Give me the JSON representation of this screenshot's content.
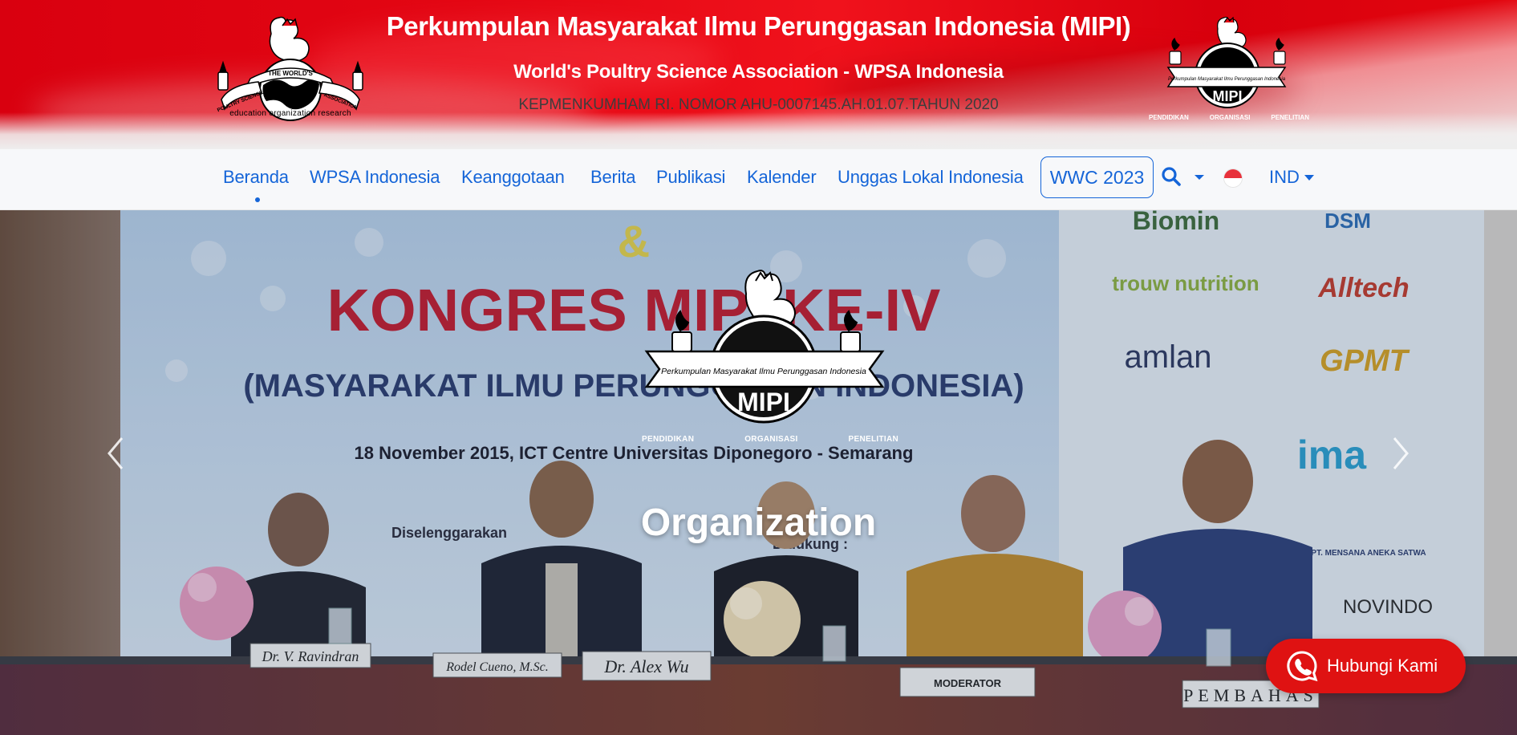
{
  "header": {
    "title": "Perkumpulan Masyarakat Ilmu Perunggasan Indonesia (MIPI)",
    "subtitle": "World's Poultry Science Association - WPSA Indonesia",
    "registration": "KEPMENKUMHAM RI. NOMOR AHU-0007145.AH.01.07.TAHUN 2020",
    "left_logo": {
      "ring_top": "THE WORLD'S",
      "ring_left": "POULTRY SCIENCE",
      "ring_right": "ASSOCIATION",
      "tagline": "education organization research"
    },
    "right_logo": {
      "banner": "Perkumpulan Masyarakat Ilmu Perunggasan Indonesia",
      "name": "MIPI",
      "tags": [
        "PENDIDIKAN",
        "ORGANISASI",
        "PENELITIAN"
      ]
    }
  },
  "nav": {
    "items": [
      {
        "label": "Beranda",
        "active": true
      },
      {
        "label": "WPSA Indonesia"
      },
      {
        "label": "Keanggotaan"
      },
      {
        "label": "Berita"
      },
      {
        "label": "Publikasi"
      },
      {
        "label": "Kalender"
      },
      {
        "label": "Unggas Lokal Indonesia"
      }
    ],
    "wwc_button": "WWC 2023",
    "search_icon": "search-icon",
    "language": "IND",
    "flag": "indonesia-flag-icon"
  },
  "hero": {
    "caption": "Organization",
    "logo": {
      "banner": "Perkumpulan Masyarakat Ilmu Perunggasan Indonesia",
      "name": "MIPI",
      "tags": [
        "PENDIDIKAN",
        "ORGANISASI",
        "PENELITIAN"
      ]
    },
    "photo": {
      "banner_line1": "KONGRES MIPI KE-IV",
      "banner_line2": "(MASYARAKAT ILMU PERUNGGASAN INDONESIA)",
      "banner_line3": "18 November 2015, ICT Centre Universitas Diponegoro - Semarang",
      "banner_line4": "Diselenggarakan",
      "banner_line4b": "Didukung :",
      "amp": "&",
      "sponsors": [
        "Biomin",
        "DSM",
        "trouw nutrition",
        "Alltech",
        "amlan",
        "GPMT",
        "ima",
        "PT. MENSANA ANEKA SATWA",
        "NOVINDO"
      ],
      "nameplates": [
        "Dr. V. Ravindran",
        "Rodel Cueno, M.Sc.",
        "Dr. Alex Wu",
        "MODERATOR",
        "PEMBAHAS"
      ]
    }
  },
  "cta": {
    "label": "Hubungi Kami",
    "icon": "whatsapp-icon",
    "color": "#df1212"
  },
  "colors": {
    "banner_red": "#e30613",
    "link_blue": "#1565d8",
    "navbar_bg": "#f7f8fa"
  }
}
